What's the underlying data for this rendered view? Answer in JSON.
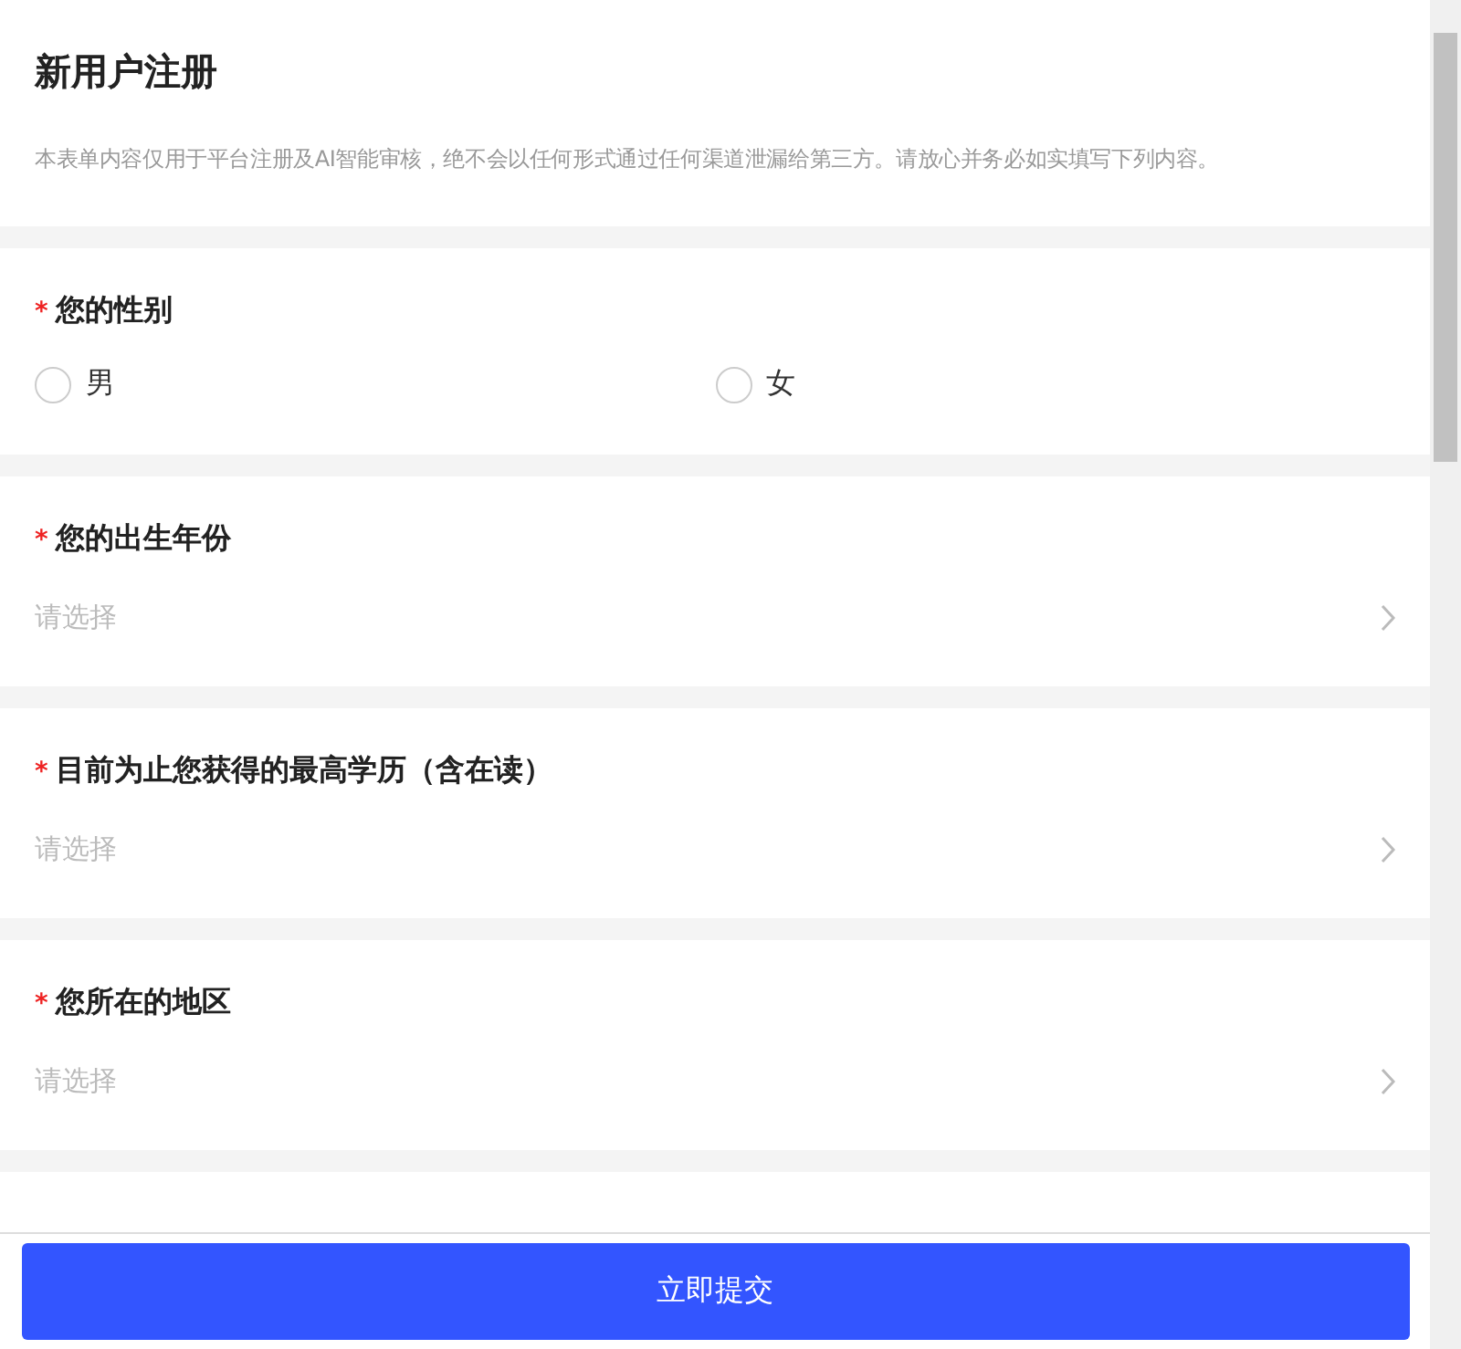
{
  "header": {
    "title": "新用户注册",
    "notice": "本表单内容仅用于平台注册及AI智能审核，绝不会以任何形式通过任何渠道泄漏给第三方。请放心并务必如实填写下列内容。"
  },
  "questions": [
    {
      "kind": "radio",
      "required_mark": "*",
      "label": "您的性别",
      "options": [
        {
          "label": "男",
          "selected": false
        },
        {
          "label": "女",
          "selected": false
        }
      ]
    },
    {
      "kind": "select",
      "required_mark": "*",
      "label": "您的出生年份",
      "placeholder": "请选择"
    },
    {
      "kind": "select",
      "required_mark": "*",
      "label": "目前为止您获得的最高学历（含在读）",
      "placeholder": "请选择"
    },
    {
      "kind": "select",
      "required_mark": "*",
      "label": "您所在的地区",
      "placeholder": "请选择"
    }
  ],
  "submit": "立即提交"
}
